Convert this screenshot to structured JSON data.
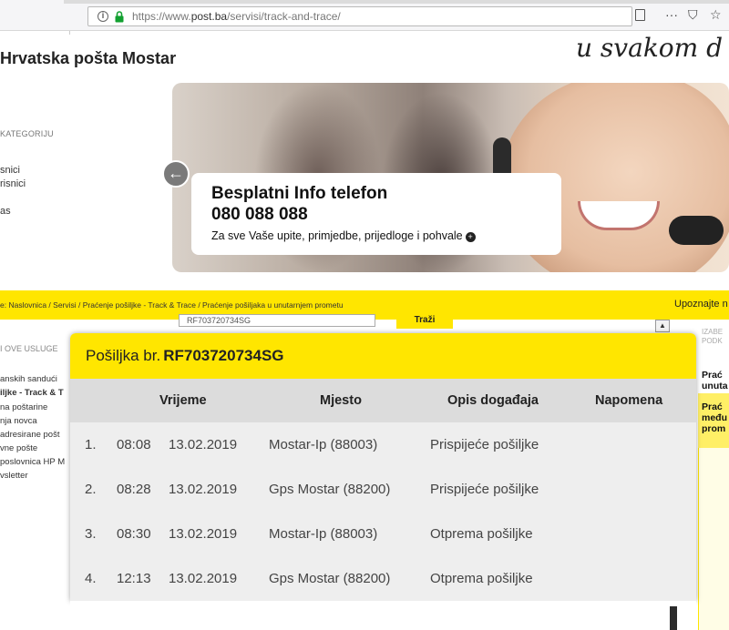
{
  "browser": {
    "url_prefix": "https://www.",
    "url_domain": "post.ba",
    "url_path": "/servisi/track-and-trace/",
    "toolbar_more": "···",
    "toolbar_pocket": "⛉",
    "toolbar_star": "☆"
  },
  "header": {
    "site_title": "Hrvatska pošta Mostar",
    "slogan": "u svakom d"
  },
  "categories": {
    "heading": "KATEGORIJU",
    "items": [
      "snici",
      "risnici",
      "as"
    ]
  },
  "banner": {
    "title": "Besplatni Info telefon",
    "phone": "080 088 088",
    "subtitle": "Za sve Vaše upite, primjedbe, prijedloge i pohvale"
  },
  "breadcrumb": {
    "prefix": "e:",
    "home": "Naslovnica",
    "path": "/ Servisi / Praćenje pošiljke - Track & Trace / Praćenje pošiljaka u unutarnjem prometu",
    "right_link": "Upoznajte n"
  },
  "background": {
    "search_value": "RF703720734SG",
    "search_button": "Traži",
    "scroll_arrow": "▲",
    "left_heading": "I OVE USLUGE",
    "left_links": [
      "anskih sandući",
      "iljke - Track & T",
      "na poštarine",
      "nja novca",
      "adresirane pošt",
      "vne pošte",
      "poslovnica HP M",
      "vsletter"
    ],
    "right_heading": [
      "IZABE",
      "PODK"
    ],
    "right_items": [
      [
        "Prać",
        "unuta"
      ],
      [
        "Prać",
        "među",
        "prom"
      ]
    ]
  },
  "shipment": {
    "title_label": "Pošiljka br.",
    "number": "RF703720734SG",
    "columns": [
      "Vrijeme",
      "Mjesto",
      "Opis događaja",
      "Napomena"
    ],
    "events": [
      {
        "index": "1.",
        "time": "08:08",
        "date": "13.02.2019",
        "place": "Mostar-Ip (88003)",
        "event": "Prispijeće pošiljke",
        "note": ""
      },
      {
        "index": "2.",
        "time": "08:28",
        "date": "13.02.2019",
        "place": "Gps Mostar (88200)",
        "event": "Prispijeće pošiljke",
        "note": ""
      },
      {
        "index": "3.",
        "time": "08:30",
        "date": "13.02.2019",
        "place": "Mostar-Ip (88003)",
        "event": "Otprema pošiljke",
        "note": ""
      },
      {
        "index": "4.",
        "time": "12:13",
        "date": "13.02.2019",
        "place": "Gps Mostar (88200)",
        "event": "Otprema pošiljke",
        "note": ""
      }
    ]
  },
  "colors": {
    "brand_yellow": "#ffe600",
    "table_bg": "#eeeeee",
    "header_row_bg": "#dcdcdc"
  }
}
